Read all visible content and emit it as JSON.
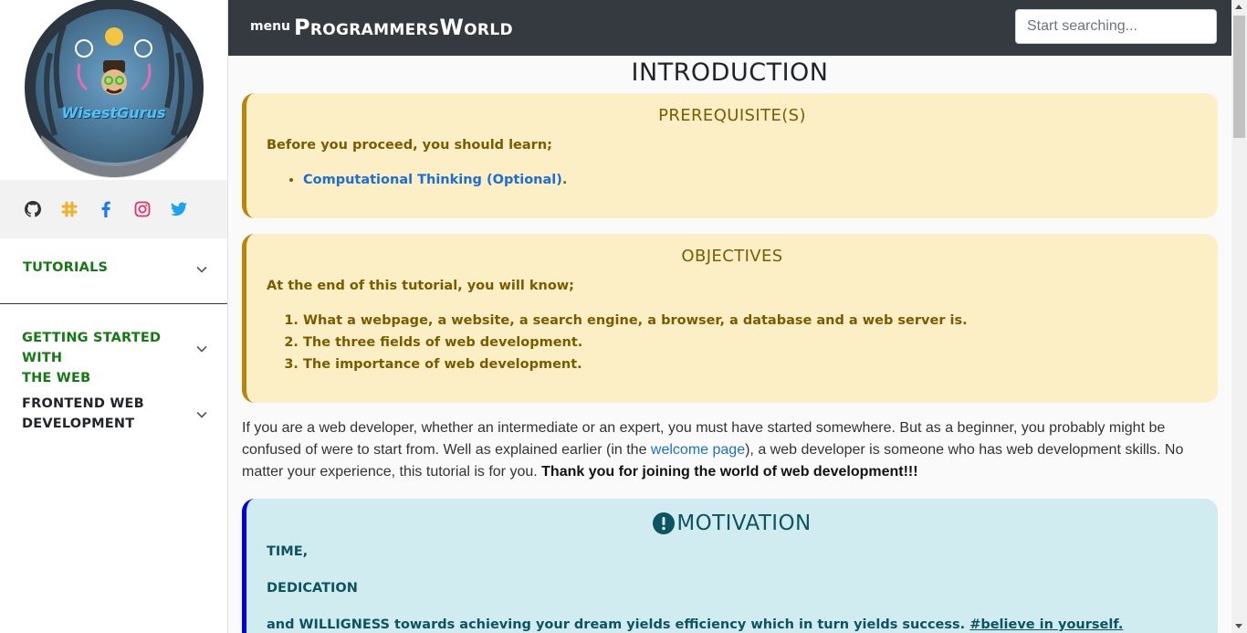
{
  "sidebar": {
    "logo_text": "WisestGurus",
    "socials": [
      {
        "icon": "github-icon",
        "color": "#333333"
      },
      {
        "icon": "slack-icon",
        "color": "#ecb22e"
      },
      {
        "icon": "facebook-icon",
        "color": "#1877f2"
      },
      {
        "icon": "instagram-icon",
        "color": "#e1306c"
      },
      {
        "icon": "twitter-icon",
        "color": "#1da1f2"
      }
    ],
    "nav": {
      "tutorials": "TUTORIALS",
      "getting_started_1": "GETTING STARTED WITH",
      "getting_started_2": "THE WEB",
      "frontend_1": "FRONTEND WEB",
      "frontend_2": "DEVELOPMENT"
    }
  },
  "header": {
    "menu_label": "menu",
    "brand": "ProgrammersWorld",
    "search_placeholder": "Start searching..."
  },
  "main": {
    "title": "INTRODUCTION",
    "prerequisites": {
      "heading": "PREREQUISITE(S)",
      "intro": "Before you proceed, you should learn;",
      "items": [
        {
          "link": "Computational Thinking (Optional)",
          "suffix": "."
        }
      ]
    },
    "objectives": {
      "heading": "OBJECTIVES",
      "intro": "At the end of this tutorial, you will know;",
      "items": [
        "What a webpage, a website, a search engine, a browser, a database and a web server is.",
        "The three fields of web development.",
        "The importance of web development."
      ]
    },
    "paragraph": {
      "part1": "If you are a web developer, whether an intermediate or an expert, you must have started somewhere. But as a beginner, you probably might be confused of were to start from. Well as explained earlier (in the ",
      "link": "welcome page",
      "part2": "), a web developer is someone who has web development skills. No matter your experience, this tutorial is for you. ",
      "bold": "Thank you for joining the world of web development!!!"
    },
    "motivation": {
      "heading": "MOTIVATION",
      "line1": "TIME,",
      "line2": "DEDICATION",
      "line3a": "and WILLIGNESS towards achieving your dream yields efficiency which in turn yields success. ",
      "line3b": "#believe in yourself."
    }
  },
  "colors": {
    "header_bg": "#343a40",
    "nav_green": "#137a13",
    "warning_bg": "#fdefc5",
    "info_bg": "#d1ecf1",
    "link": "#1a6fd6"
  }
}
